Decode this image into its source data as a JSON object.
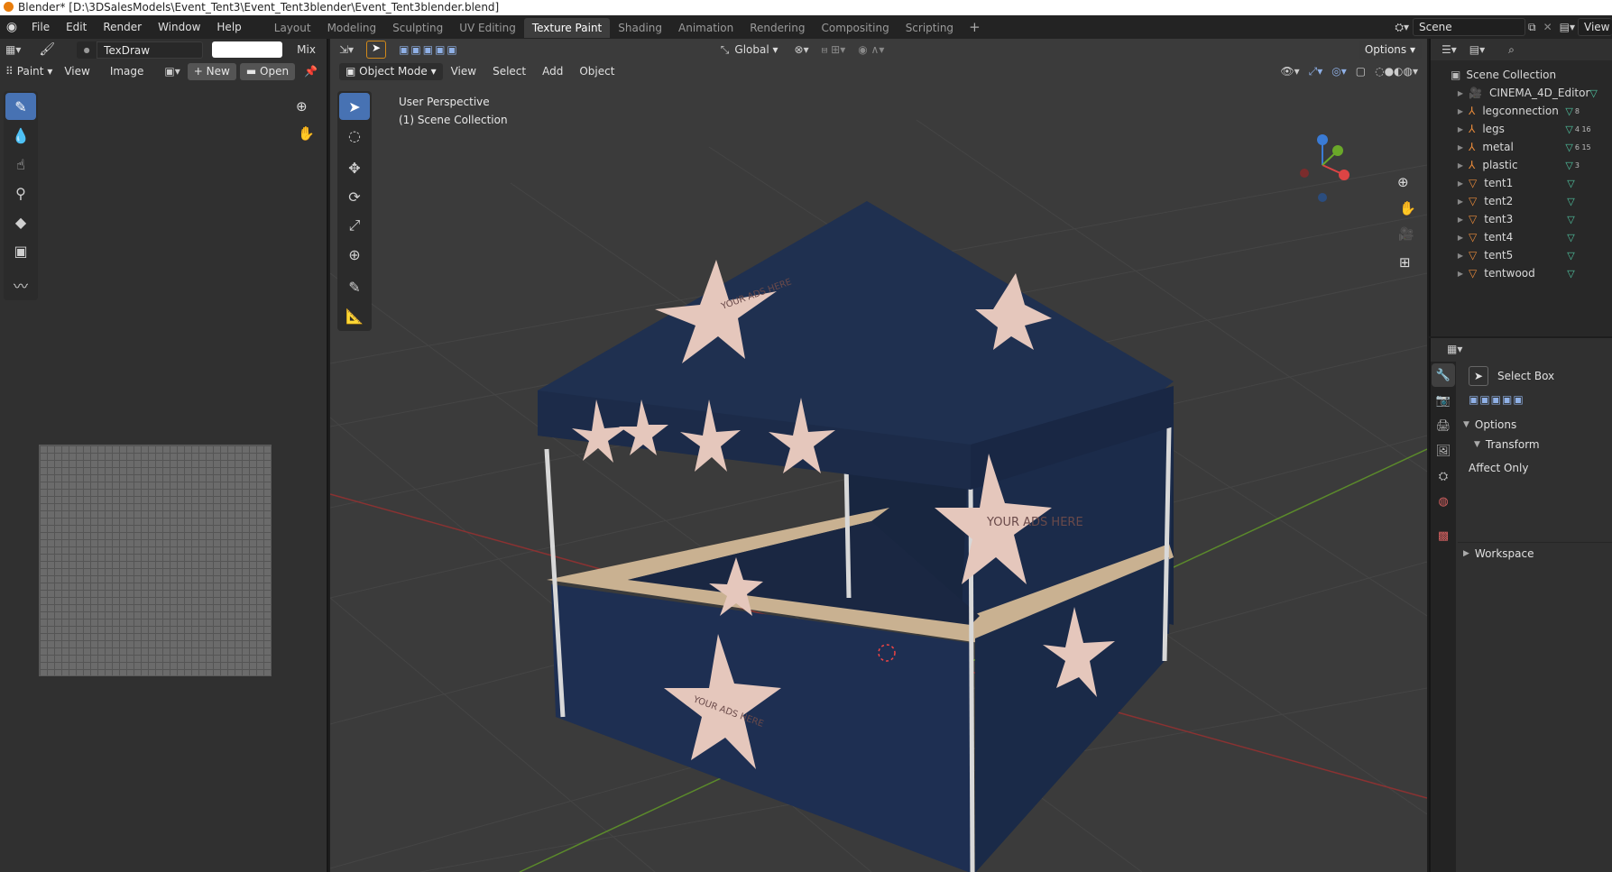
{
  "window": {
    "title": "Blender* [D:\\3DSalesModels\\Event_Tent3\\Event_Tent3blender\\Event_Tent3blender.blend]"
  },
  "menu": [
    "File",
    "Edit",
    "Render",
    "Window",
    "Help"
  ],
  "workspaces": [
    "Layout",
    "Modeling",
    "Sculpting",
    "UV Editing",
    "Texture Paint",
    "Shading",
    "Animation",
    "Rendering",
    "Compositing",
    "Scripting"
  ],
  "active_workspace": "Texture Paint",
  "scene": {
    "name": "Scene",
    "view_layer": "View L"
  },
  "image_editor": {
    "brush_name": "TexDraw",
    "blend_mode": "Mix",
    "mode": "Paint",
    "view": "View",
    "image": "Image",
    "new": "New",
    "open": "Open",
    "tools": [
      "draw-brush-icon",
      "soften-icon",
      "smear-icon",
      "clone-icon",
      "fill-icon",
      "mask-icon",
      "annotate-icon"
    ]
  },
  "viewport": {
    "mode": "Object Mode",
    "view": "View",
    "select": "Select",
    "add": "Add",
    "object": "Object",
    "orientation": "Global",
    "options": "Options",
    "perspective": "User Perspective",
    "collection": "(1) Scene Collection",
    "tent_text": "YOUR ADS HERE",
    "colors": {
      "canvas": "#3b3b3b",
      "tent": "#1d2d4d",
      "star": "#e5c7bc",
      "counter": "#c9b191",
      "pole": "#d8d8d8",
      "accent": "#4772b3"
    }
  },
  "outliner": {
    "root": "Scene Collection",
    "items": [
      {
        "name": "CINEMA_4D_Editor",
        "type": "camera-icon",
        "extra": ""
      },
      {
        "name": "legconnection",
        "type": "armature-icon",
        "extra": "8"
      },
      {
        "name": "legs",
        "type": "armature-icon",
        "extra": "4 16"
      },
      {
        "name": "metal",
        "type": "armature-icon",
        "extra": "6 15"
      },
      {
        "name": "plastic",
        "type": "armature-icon",
        "extra": "3"
      },
      {
        "name": "tent1",
        "type": "mesh-icon",
        "extra": ""
      },
      {
        "name": "tent2",
        "type": "mesh-icon",
        "extra": ""
      },
      {
        "name": "tent3",
        "type": "mesh-icon",
        "extra": ""
      },
      {
        "name": "tent4",
        "type": "mesh-icon",
        "extra": ""
      },
      {
        "name": "tent5",
        "type": "mesh-icon",
        "extra": ""
      },
      {
        "name": "tentwood",
        "type": "mesh-icon",
        "extra": ""
      }
    ]
  },
  "properties": {
    "active_tool": "Select Box",
    "options": "Options",
    "transform": "Transform",
    "affect_only": "Affect Only",
    "workspace": "Workspace"
  }
}
